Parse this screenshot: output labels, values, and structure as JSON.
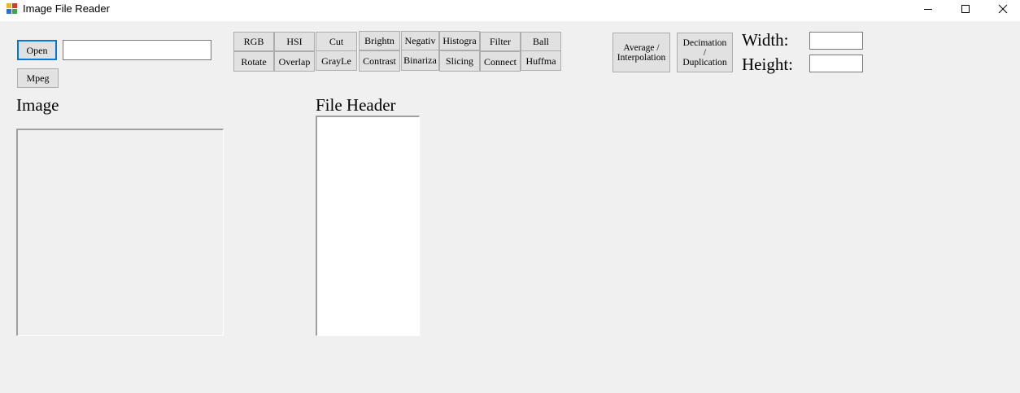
{
  "window": {
    "title": "Image File Reader",
    "icon": "app-icon",
    "controls": [
      "minimize-icon",
      "maximize-icon",
      "close-icon"
    ]
  },
  "toolbar": {
    "open_label": "Open",
    "mpeg_label": "Mpeg",
    "file_path_value": ""
  },
  "ops_row1": [
    "RGB",
    "HSI",
    "Cut",
    "Brightn",
    "Negativ",
    "Histogra",
    "Filter",
    "Ball"
  ],
  "ops_row2": [
    "Rotate",
    "Overlap",
    "GrayLe",
    "Contrast",
    "Binariza",
    "Slicing",
    "Connect",
    "Huffma"
  ],
  "resize": {
    "average_label": "Average /\nInterpolation",
    "decimation_label": "Decimation\n/\nDuplication",
    "width_label": "Width:",
    "height_label": "Height:",
    "width_value": "",
    "height_value": ""
  },
  "sections": {
    "image_label": "Image",
    "file_header_label": "File Header"
  }
}
